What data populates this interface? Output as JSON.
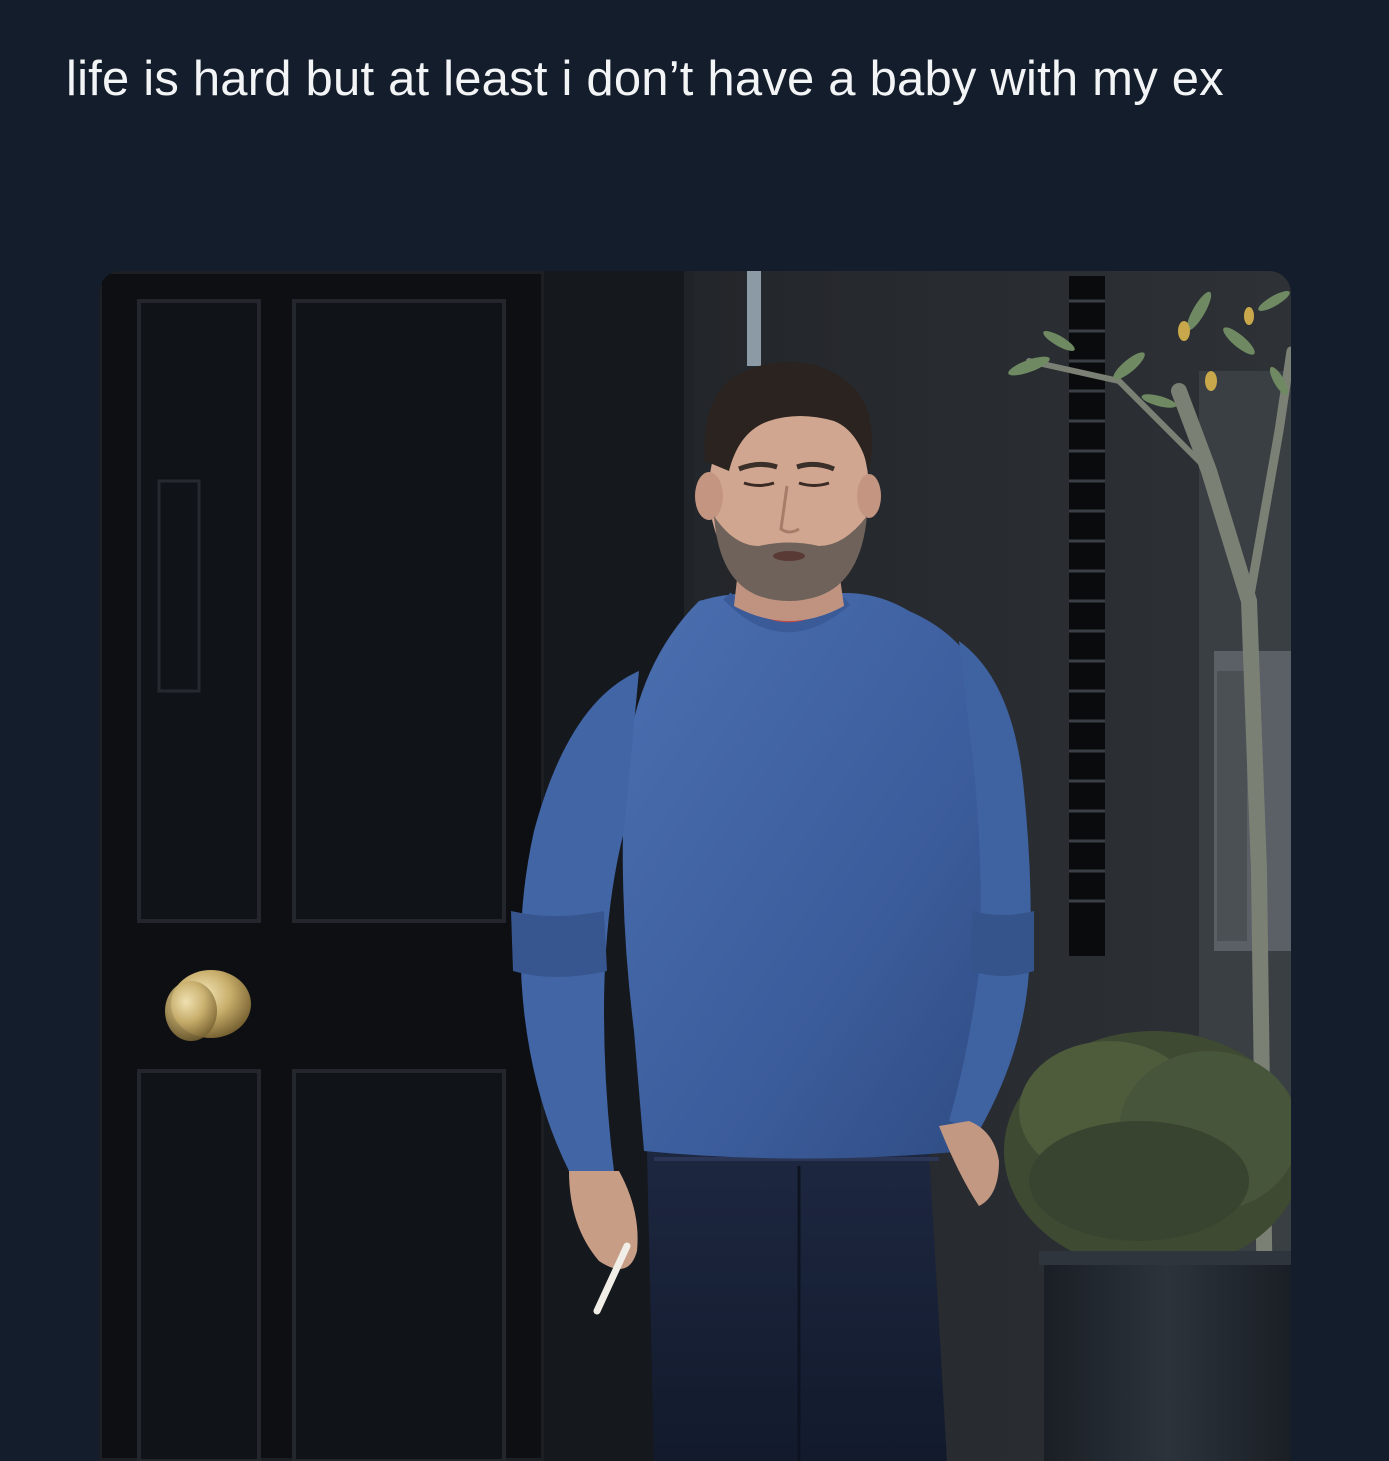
{
  "tweet": {
    "text": "life is hard but at least i don’t have a baby with my ex"
  },
  "media": {
    "kind": "photo"
  },
  "colors": {
    "background": "#141d2b",
    "text": "#f2f4f6"
  }
}
